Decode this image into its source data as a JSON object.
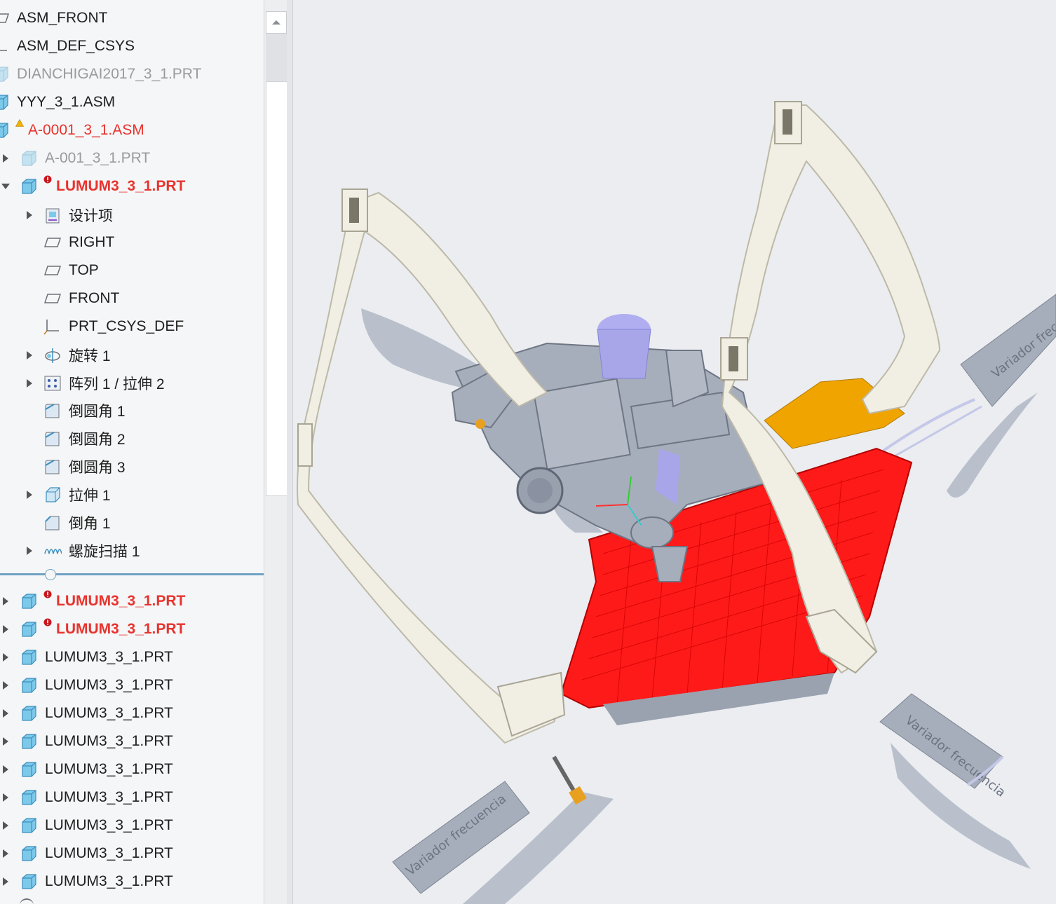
{
  "model_tree": {
    "rows": [
      {
        "label": "ASM_FRONT",
        "icon": "datum-plane-icon"
      },
      {
        "label": "ASM_DEF_CSYS",
        "icon": "csys-icon"
      },
      {
        "label": "DIANCHIGAI2017_3_1.PRT",
        "icon": "part-icon",
        "state": "suppressed"
      },
      {
        "label": "YYY_3_1.ASM",
        "icon": "assembly-icon"
      },
      {
        "label": "A-0001_3_1.ASM",
        "icon": "assembly-icon",
        "state": "warning"
      },
      {
        "label": "A-001_3_1.PRT",
        "icon": "part-icon",
        "state": "suppressed"
      },
      {
        "label": "LUMUM3_3_1.PRT",
        "icon": "part-icon",
        "state": "error"
      },
      {
        "label": "设计项",
        "icon": "design-items-icon"
      },
      {
        "label": "RIGHT",
        "icon": "datum-plane-icon"
      },
      {
        "label": "TOP",
        "icon": "datum-plane-icon"
      },
      {
        "label": "FRONT",
        "icon": "datum-plane-icon"
      },
      {
        "label": "PRT_CSYS_DEF",
        "icon": "csys-icon"
      },
      {
        "label": "旋转 1",
        "icon": "revolve-icon"
      },
      {
        "label": "阵列 1 / 拉伸 2",
        "icon": "pattern-icon"
      },
      {
        "label": "倒圆角 1",
        "icon": "round-icon"
      },
      {
        "label": "倒圆角 2",
        "icon": "round-icon"
      },
      {
        "label": "倒圆角 3",
        "icon": "round-icon"
      },
      {
        "label": "拉伸 1",
        "icon": "extrude-icon"
      },
      {
        "label": "倒角 1",
        "icon": "chamfer-icon"
      },
      {
        "label": "螺旋扫描 1",
        "icon": "helical-sweep-icon"
      },
      {
        "label": "LUMUM3_3_1.PRT",
        "icon": "part-icon",
        "state": "error"
      },
      {
        "label": "LUMUM3_3_1.PRT",
        "icon": "part-icon",
        "state": "error"
      },
      {
        "label": "LUMUM3_3_1.PRT",
        "icon": "part-icon"
      },
      {
        "label": "LUMUM3_3_1.PRT",
        "icon": "part-icon"
      },
      {
        "label": "LUMUM3_3_1.PRT",
        "icon": "part-icon"
      },
      {
        "label": "LUMUM3_3_1.PRT",
        "icon": "part-icon"
      },
      {
        "label": "LUMUM3_3_1.PRT",
        "icon": "part-icon"
      },
      {
        "label": "LUMUM3_3_1.PRT",
        "icon": "part-icon"
      },
      {
        "label": "LUMUM3_3_1.PRT",
        "icon": "part-icon"
      },
      {
        "label": "LUMUM3_3_1.PRT",
        "icon": "part-icon"
      },
      {
        "label": "LUMUM3_3_1.PRT",
        "icon": "part-icon"
      }
    ]
  },
  "viewport": {
    "esc_labels": [
      "Variador frecuencia",
      "Variador frecuencia",
      "Variador frecuencia"
    ]
  },
  "colors": {
    "error_red": "#e8332d",
    "highlight_red": "#ff1a1a",
    "frame": "#f1efe4",
    "part_gray": "#a7aebb",
    "motor": "#a8a6e8",
    "orange": "#f0a400",
    "splitter": "#6fa2c4"
  }
}
